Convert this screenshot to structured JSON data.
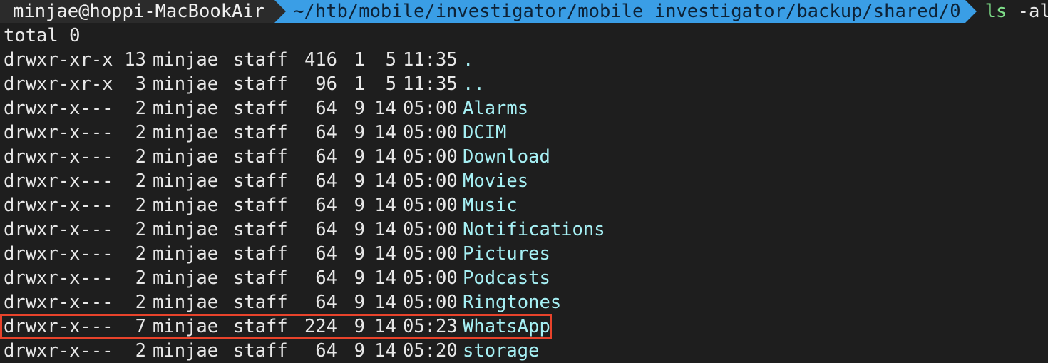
{
  "prompt": {
    "user_host": "minjae@hoppi-MacBookAir",
    "path": "~/htb/mobile/investigator/mobile_investigator/backup/shared/0",
    "command": "ls",
    "args": " -al"
  },
  "total_line": "total 0",
  "entries": [
    {
      "perm": "drwxr-xr-x",
      "links": "13",
      "owner": "minjae",
      "group": "staff",
      "size": "416",
      "month": "1",
      "day": "5",
      "time": "11:35",
      "name": "."
    },
    {
      "perm": "drwxr-xr-x",
      "links": "3",
      "owner": "minjae",
      "group": "staff",
      "size": "96",
      "month": "1",
      "day": "5",
      "time": "11:35",
      "name": ".."
    },
    {
      "perm": "drwxr-x---",
      "links": "2",
      "owner": "minjae",
      "group": "staff",
      "size": "64",
      "month": "9",
      "day": "14",
      "time": "05:00",
      "name": "Alarms"
    },
    {
      "perm": "drwxr-x---",
      "links": "2",
      "owner": "minjae",
      "group": "staff",
      "size": "64",
      "month": "9",
      "day": "14",
      "time": "05:00",
      "name": "DCIM"
    },
    {
      "perm": "drwxr-x---",
      "links": "2",
      "owner": "minjae",
      "group": "staff",
      "size": "64",
      "month": "9",
      "day": "14",
      "time": "05:00",
      "name": "Download"
    },
    {
      "perm": "drwxr-x---",
      "links": "2",
      "owner": "minjae",
      "group": "staff",
      "size": "64",
      "month": "9",
      "day": "14",
      "time": "05:00",
      "name": "Movies"
    },
    {
      "perm": "drwxr-x---",
      "links": "2",
      "owner": "minjae",
      "group": "staff",
      "size": "64",
      "month": "9",
      "day": "14",
      "time": "05:00",
      "name": "Music"
    },
    {
      "perm": "drwxr-x---",
      "links": "2",
      "owner": "minjae",
      "group": "staff",
      "size": "64",
      "month": "9",
      "day": "14",
      "time": "05:00",
      "name": "Notifications"
    },
    {
      "perm": "drwxr-x---",
      "links": "2",
      "owner": "minjae",
      "group": "staff",
      "size": "64",
      "month": "9",
      "day": "14",
      "time": "05:00",
      "name": "Pictures"
    },
    {
      "perm": "drwxr-x---",
      "links": "2",
      "owner": "minjae",
      "group": "staff",
      "size": "64",
      "month": "9",
      "day": "14",
      "time": "05:00",
      "name": "Podcasts"
    },
    {
      "perm": "drwxr-x---",
      "links": "2",
      "owner": "minjae",
      "group": "staff",
      "size": "64",
      "month": "9",
      "day": "14",
      "time": "05:00",
      "name": "Ringtones"
    },
    {
      "perm": "drwxr-x---",
      "links": "7",
      "owner": "minjae",
      "group": "staff",
      "size": "224",
      "month": "9",
      "day": "14",
      "time": "05:23",
      "name": "WhatsApp"
    },
    {
      "perm": "drwxr-x---",
      "links": "2",
      "owner": "minjae",
      "group": "staff",
      "size": "64",
      "month": "9",
      "day": "14",
      "time": "05:20",
      "name": "storage"
    }
  ],
  "colors": {
    "background": "#1e1e1e",
    "path_segment": "#3a9ee6",
    "command": "#7fe08a",
    "directory_name": "#a6f0f4",
    "highlight_box": "#e8432b"
  }
}
